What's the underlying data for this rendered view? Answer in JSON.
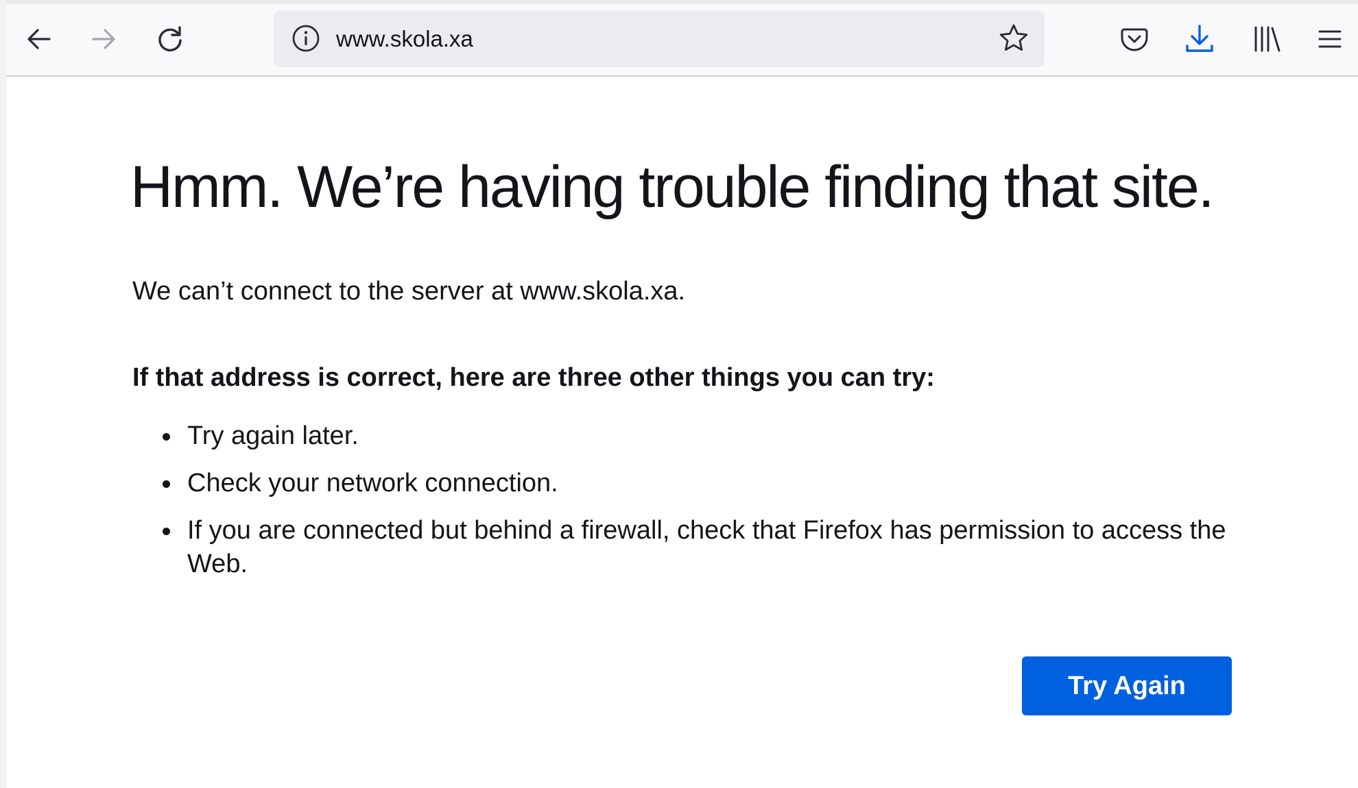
{
  "browser": {
    "url": "www.skola.xa",
    "accent_color": "#0061e0",
    "icons": {
      "back": "arrow-left-icon",
      "forward": "arrow-right-icon",
      "reload": "reload-icon",
      "site_info": "info-circle-icon",
      "bookmark": "star-outline-icon",
      "pocket": "pocket-icon",
      "downloads": "download-icon",
      "library": "library-icon",
      "menu": "hamburger-menu-icon"
    }
  },
  "error_page": {
    "title": "Hmm. We’re having trouble finding that site.",
    "description": "We can’t connect to the server at www.skola.xa.",
    "suggestions_heading": "If that address is correct, here are three other things you can try:",
    "suggestions": [
      "Try again later.",
      "Check your network connection.",
      "If you are connected but behind a firewall, check that Firefox has permission to access the Web."
    ],
    "try_again_label": "Try Again"
  }
}
